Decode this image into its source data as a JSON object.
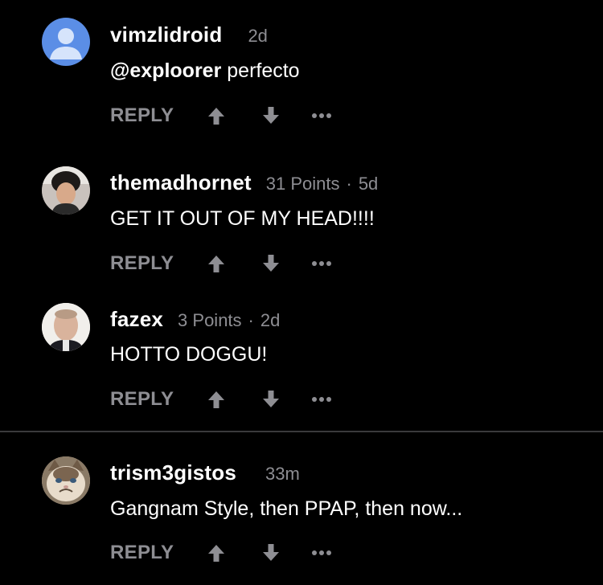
{
  "comments": [
    {
      "username": "vimzlidroid",
      "points": "",
      "time": "2d",
      "mention": "@exploorer",
      "text": " perfecto",
      "reply_label": "REPLY",
      "avatar_icon": "default-user-avatar-icon"
    },
    {
      "username": "themadhornet",
      "points": "31 Points",
      "time": "5d",
      "text": "GET IT OUT OF MY HEAD!!!!",
      "reply_label": "REPLY",
      "avatar_icon": "user-photo-avatar"
    },
    {
      "username": "fazex",
      "points": "3 Points",
      "time": "2d",
      "text": "HOTTO DOGGU!",
      "reply_label": "REPLY",
      "avatar_icon": "user-photo-avatar"
    },
    {
      "username": "trism3gistos",
      "points": "",
      "time": "33m",
      "text": "Gangnam Style, then PPAP, then now...",
      "reply_label": "REPLY",
      "avatar_icon": "grumpy-cat-avatar"
    }
  ],
  "separator": "·",
  "colors": {
    "background": "#000000",
    "secondary_text": "#8e8e93",
    "default_avatar_bg": "#5b8ee6",
    "divider": "#3a3a3c"
  }
}
